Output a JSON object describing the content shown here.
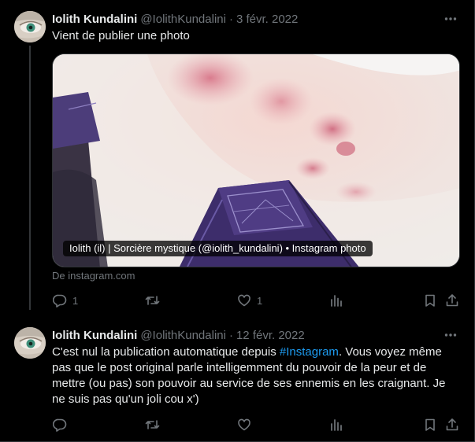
{
  "tweets": [
    {
      "author_name": "Iolith Kundalini",
      "handle": "@IolithKundalini",
      "separator": "·",
      "date": "3 févr. 2022",
      "text": "Vient de publier une photo",
      "media": {
        "caption": "Iolith (il) | Sorcière mystique (@iolith_kundalini) • Instagram photo",
        "source": "De instagram.com"
      },
      "actions": {
        "replies": "1",
        "retweets": "",
        "likes": "1"
      }
    },
    {
      "author_name": "Iolith Kundalini",
      "handle": "@IolithKundalini",
      "separator": "·",
      "date": "12 févr. 2022",
      "text_before": "C'est nul la publication automatique depuis ",
      "hashtag": "#Instagram",
      "text_after": ". Vous voyez même pas que le post original parle intelligemment du pouvoir de la peur et de mettre (ou pas) son pouvoir au service de ses ennemis en les craignant. Je ne suis pas qu'un joli cou x')",
      "actions": {
        "replies": "",
        "retweets": "",
        "likes": ""
      }
    }
  ],
  "colors": {
    "background": "#000000",
    "text_primary": "#e7e9ea",
    "text_secondary": "#71767b",
    "link": "#1d9bf0",
    "border": "#2f3336"
  },
  "icons": [
    "more-icon",
    "reply-icon",
    "retweet-icon",
    "like-icon",
    "views-icon",
    "bookmark-icon",
    "share-icon"
  ]
}
